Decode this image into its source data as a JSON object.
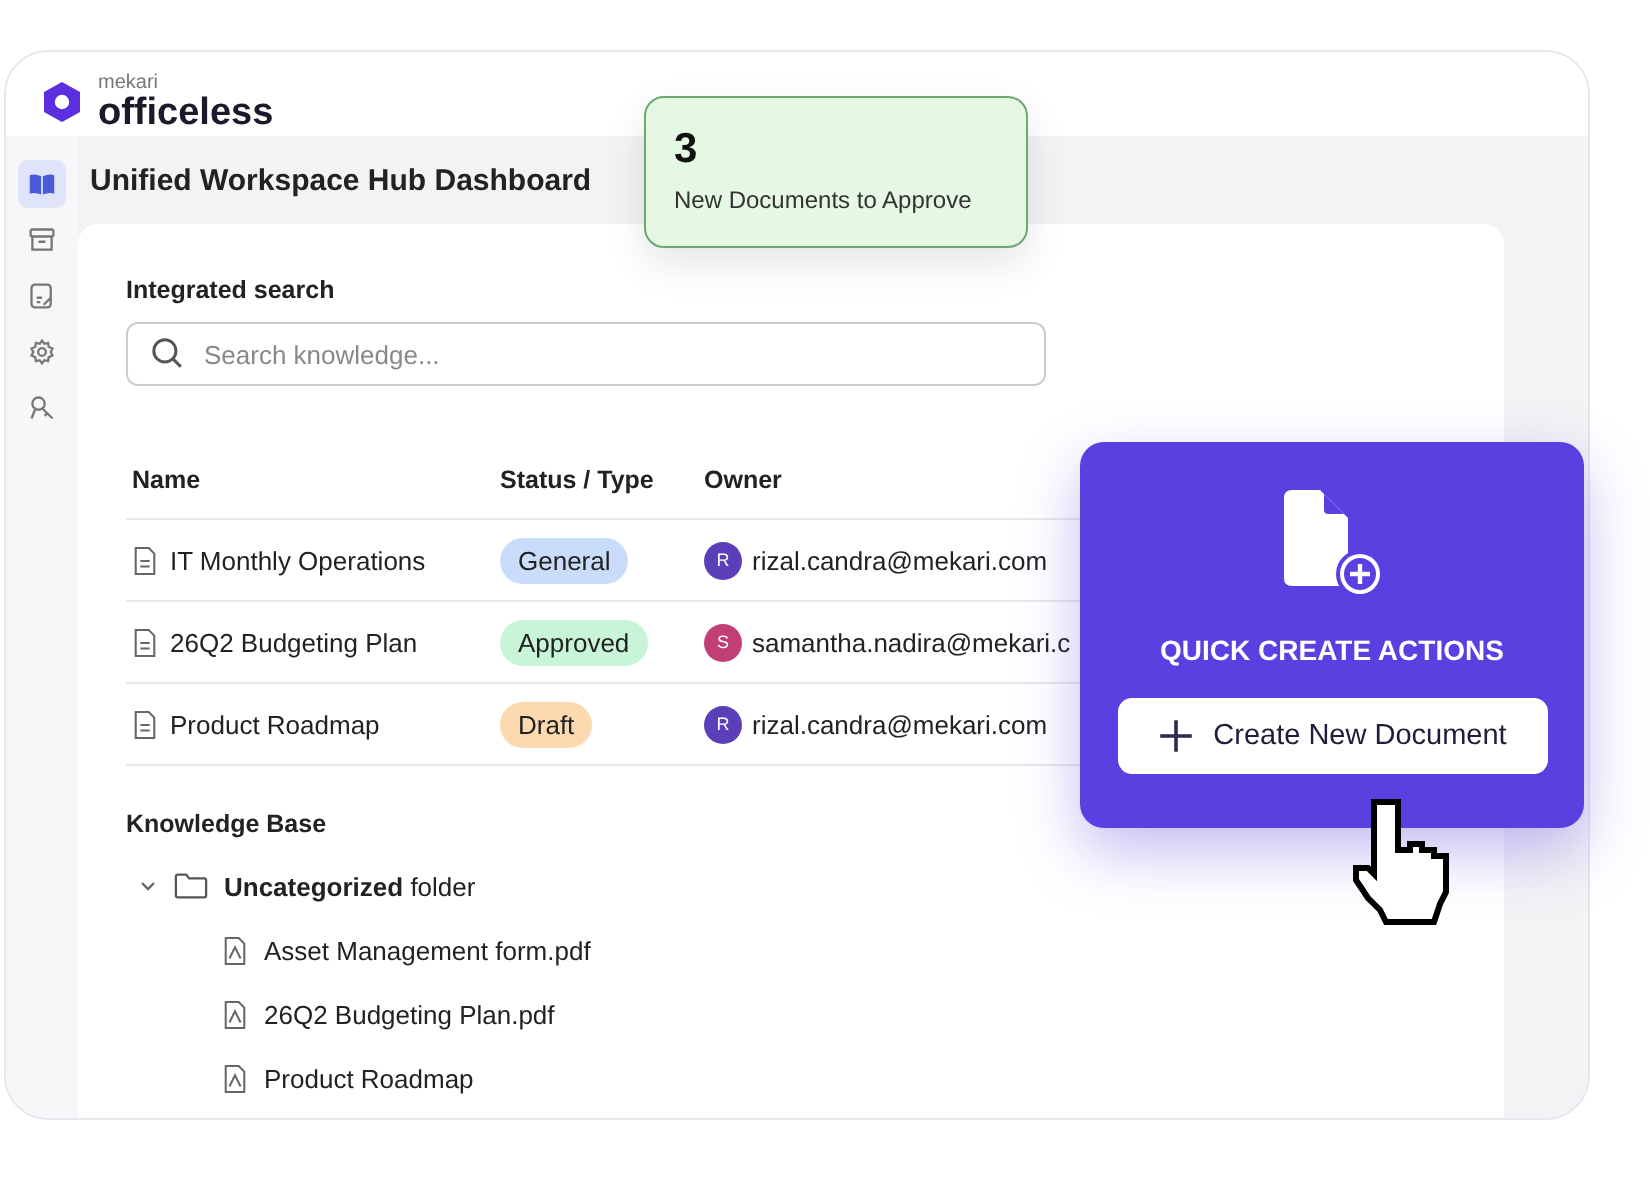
{
  "brand": {
    "small": "mekari",
    "name": "officeless"
  },
  "sidebar": {
    "items": [
      {
        "selected": true
      },
      {
        "selected": false
      },
      {
        "selected": false
      },
      {
        "selected": false
      },
      {
        "selected": false
      }
    ]
  },
  "title": "Unified Workspace Hub Dashboard",
  "notification": {
    "count": "3",
    "text": "New Documents to Approve"
  },
  "search": {
    "label": "Integrated search",
    "placeholder": "Search knowledge..."
  },
  "table": {
    "columns": [
      "Name",
      "Status / Type",
      "Owner"
    ],
    "rows": [
      {
        "name": "IT Monthly Operations",
        "status": {
          "label": "General",
          "color": "#c9dcfa"
        },
        "avatar": {
          "initial": "R",
          "color": "#5b3fb8"
        },
        "owner": "rizal.candra@mekari.com"
      },
      {
        "name": "26Q2 Budgeting Plan",
        "status": {
          "label": "Approved",
          "color": "#c8f5d8"
        },
        "avatar": {
          "initial": "S",
          "color": "#c23f76"
        },
        "owner": "samantha.nadira@mekari.c"
      },
      {
        "name": "Product Roadmap",
        "status": {
          "label": "Draft",
          "color": "#fcd9ae"
        },
        "avatar": {
          "initial": "R",
          "color": "#5b3fb8"
        },
        "owner": "rizal.candra@mekari.com"
      }
    ]
  },
  "knowledge_base": {
    "title": "Knowledge Base",
    "tree": [
      {
        "label": "**Uncategorized** folder",
        "kind": "folder",
        "expanded": true,
        "children": [
          {
            "label": "Asset Management form.pdf",
            "kind": "pdf"
          },
          {
            "label": "26Q2 Budgeting Plan.pdf",
            "kind": "pdf"
          },
          {
            "label": "Product Roadmap",
            "kind": "pdf"
          }
        ]
      }
    ]
  },
  "quick_create": {
    "title": "QUICK CREATE ACTIONS",
    "button": "Create New Document"
  }
}
